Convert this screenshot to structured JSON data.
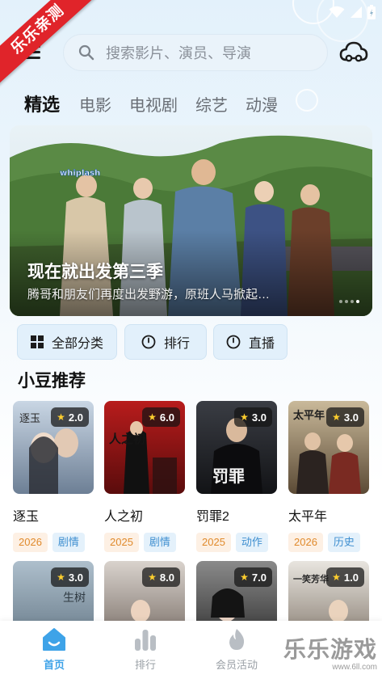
{
  "status_bar": {
    "icons": [
      "wifi-icon",
      "signal-icon",
      "battery-icon"
    ]
  },
  "watermark": {
    "ribbon": "乐乐亲测",
    "brand": "乐乐游戏",
    "url": "www.6ll.com"
  },
  "search": {
    "placeholder": "搜索影片、演员、导演"
  },
  "tabs": [
    {
      "label": "精选",
      "active": true
    },
    {
      "label": "电影",
      "active": false
    },
    {
      "label": "电视剧",
      "active": false
    },
    {
      "label": "综艺",
      "active": false
    },
    {
      "label": "动漫",
      "active": false
    }
  ],
  "banner": {
    "title": "现在就出发第三季",
    "subtitle": "腾哥和朋友们再度出发野游，原班人马掀起…",
    "poster_text": "whiplash",
    "dots": 4,
    "active_dot": 3
  },
  "categories": [
    {
      "label": "全部分类",
      "icon": "grid-icon"
    },
    {
      "label": "排行",
      "icon": "clock-icon"
    },
    {
      "label": "直播",
      "icon": "clock-icon"
    }
  ],
  "section": {
    "title": "小豆推荐"
  },
  "cards": [
    {
      "title": "逐玉",
      "rating": "2.0",
      "year": "2026",
      "genre": "剧情",
      "poster_text": "逐玉",
      "color_a": "#c9d6e4",
      "color_b": "#6d7f95"
    },
    {
      "title": "人之初",
      "rating": "6.0",
      "year": "2025",
      "genre": "剧情",
      "poster_text": "人之初",
      "color_a": "#b81c1c",
      "color_b": "#5a0c0c"
    },
    {
      "title": "罚罪2",
      "rating": "3.0",
      "year": "2025",
      "genre": "动作",
      "poster_text": "罚罪",
      "color_a": "#3a3d44",
      "color_b": "#121316"
    },
    {
      "title": "太平年",
      "rating": "3.0",
      "year": "2026",
      "genre": "历史",
      "poster_text": "太平年",
      "color_a": "#c9b99a",
      "color_b": "#5b4a35"
    }
  ],
  "cards_row2": [
    {
      "rating": "3.0",
      "poster_text": "生树",
      "color_a": "#aebfcc",
      "color_b": "#5e7180"
    },
    {
      "rating": "8.0",
      "poster_text": "",
      "color_a": "#d9d3cd",
      "color_b": "#6b5f58"
    },
    {
      "rating": "7.0",
      "poster_text": "",
      "color_a": "#8a8a8a",
      "color_b": "#262626"
    },
    {
      "rating": "1.0",
      "poster_text": "一笑芳华",
      "color_a": "#e8e5df",
      "color_b": "#7a6e62"
    }
  ],
  "nav": [
    {
      "label": "首页",
      "icon": "home-icon",
      "active": true
    },
    {
      "label": "排行",
      "icon": "bar-chart-icon",
      "active": false
    },
    {
      "label": "会员活动",
      "icon": "flame-icon",
      "active": false
    }
  ],
  "colors": {
    "accent": "#3ea3e8",
    "year_chip": "#e08a2c",
    "genre_chip": "#3f8fd0",
    "ribbon": "#e0242a",
    "star": "#ffcf2e"
  }
}
